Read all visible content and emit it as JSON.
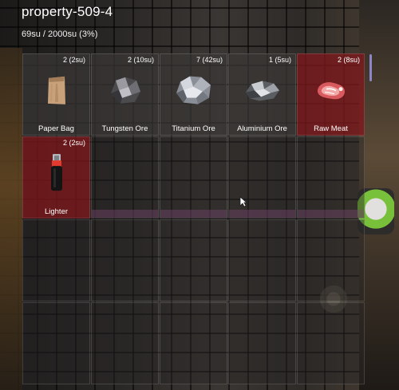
{
  "inventory": {
    "title": "property-509-4",
    "weight": "69su / 2000su (3%)"
  },
  "items": [
    {
      "name": "Paper Bag",
      "count": "2 (2su)",
      "icon": "paper-bag-icon",
      "illegal": false
    },
    {
      "name": "Tungsten Ore",
      "count": "2 (10su)",
      "icon": "tungsten-ore-icon",
      "illegal": false
    },
    {
      "name": "Titanium Ore",
      "count": "7 (42su)",
      "icon": "titanium-ore-icon",
      "illegal": false
    },
    {
      "name": "Aluminium Ore",
      "count": "1 (5su)",
      "icon": "aluminium-ore-icon",
      "illegal": false
    },
    {
      "name": "Raw Meat",
      "count": "2 (8su)",
      "icon": "raw-meat-icon",
      "illegal": true
    },
    {
      "name": "Lighter",
      "count": "2 (2su)",
      "icon": "lighter-icon",
      "illegal": true
    }
  ],
  "colors": {
    "illegal_slot": "#7d181c",
    "scrollbar": "#8e86c8"
  }
}
